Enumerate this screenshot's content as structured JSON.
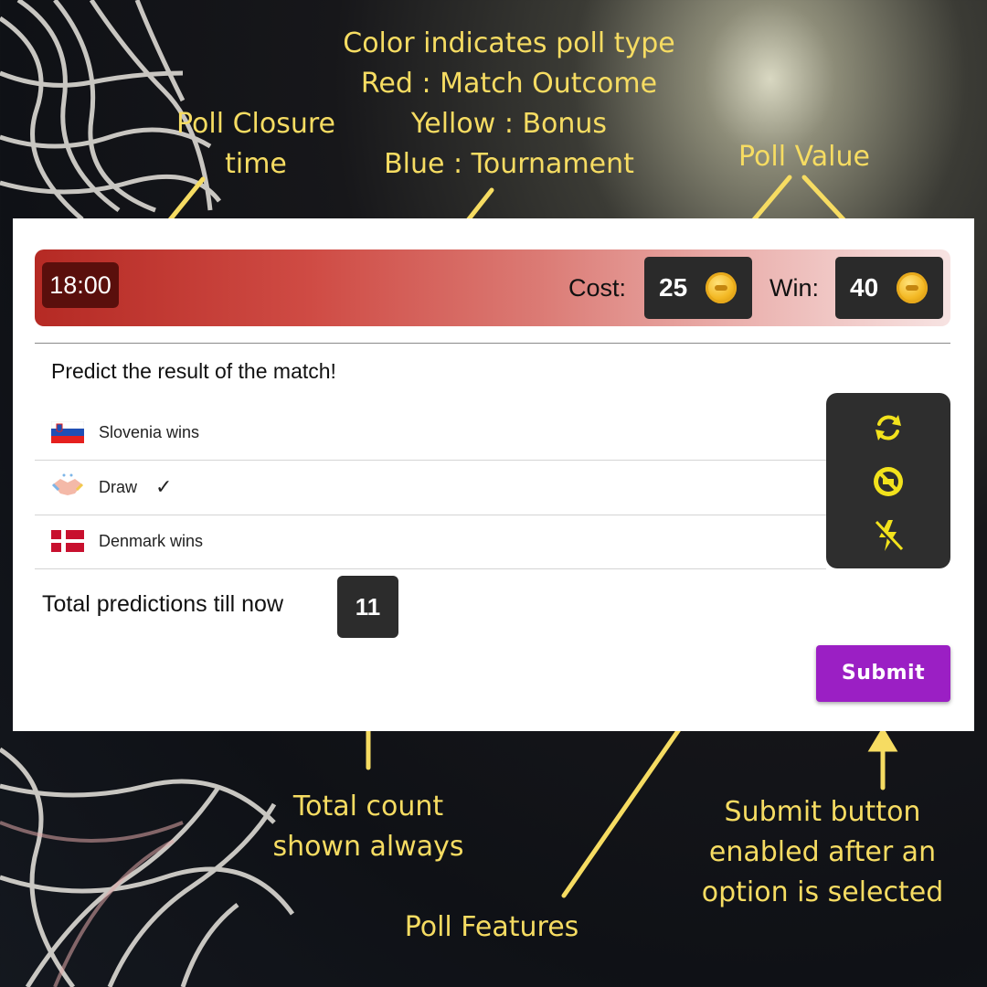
{
  "annotations": {
    "poll_type": [
      "Color indicates poll type",
      "Red : Match Outcome",
      "Yellow : Bonus",
      "Blue : Tournament"
    ],
    "closure_time": [
      "Poll Closure",
      "time"
    ],
    "poll_value": "Poll Value",
    "total_count": [
      "Total count",
      "shown always"
    ],
    "submit_note": [
      "Submit button",
      "enabled after an",
      "option is selected"
    ],
    "poll_features": "Poll Features"
  },
  "poll": {
    "type": "Match Outcome",
    "type_color": "#c0302a",
    "timer": "18:00",
    "cost_label": "Cost:",
    "cost_value": "25",
    "win_label": "Win:",
    "win_value": "40",
    "question": "Predict the result of the match!",
    "options": [
      {
        "label": "Slovenia wins",
        "icon": "slovenia-flag-icon",
        "selected": false
      },
      {
        "label": "Draw",
        "icon": "handshake-icon",
        "selected": true,
        "check": "✓"
      },
      {
        "label": "Denmark wins",
        "icon": "denmark-flag-icon",
        "selected": false
      }
    ],
    "total_label": "Total predictions till now",
    "total_value": "11",
    "features": [
      "refresh-icon",
      "no-ads-icon",
      "flash-off-icon"
    ],
    "feature_color": "#f2e21c",
    "submit_label": "Submit",
    "submit_color": "#9b1fc4",
    "annotation_color": "#f6dc62"
  }
}
